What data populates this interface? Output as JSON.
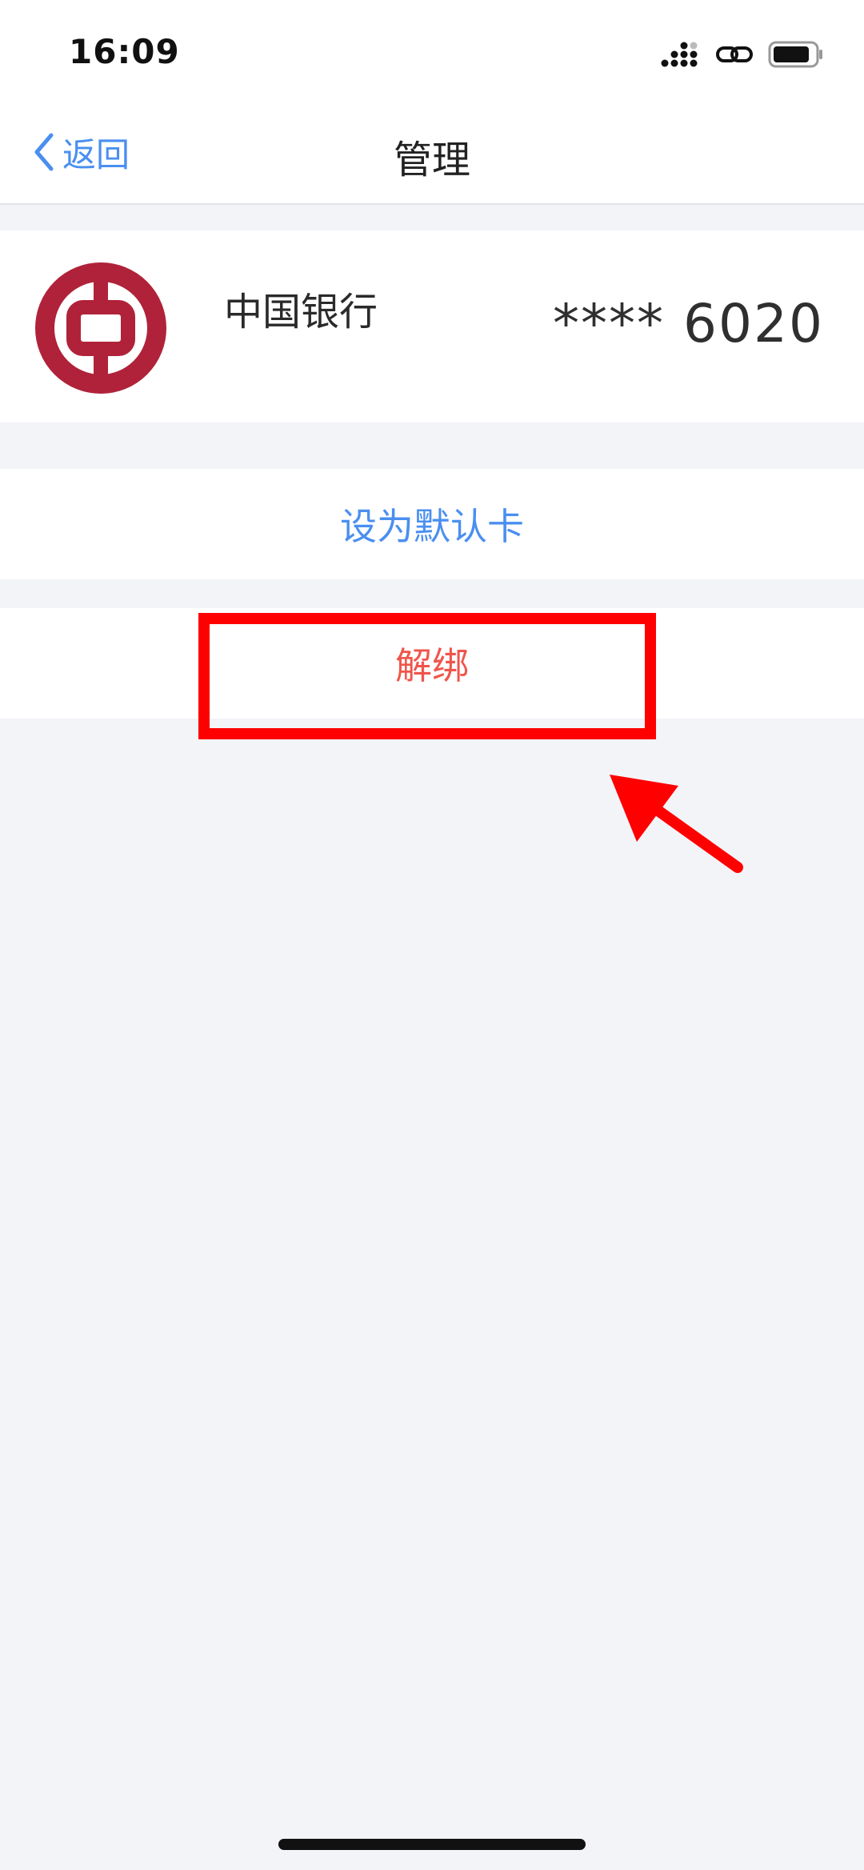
{
  "status_bar": {
    "time": "16:09",
    "icons": [
      "signal-icon",
      "link-icon",
      "battery-icon"
    ]
  },
  "nav": {
    "back_label": "返回",
    "title": "管理"
  },
  "card": {
    "bank_name": "中国银行",
    "card_number": "**** 6020",
    "logo": "bank-of-china-logo"
  },
  "actions": {
    "set_default_label": "设为默认卡",
    "unbind_label": "解绑"
  },
  "colors": {
    "accent_blue": "#4a8ff0",
    "danger_red": "#f0554a",
    "logo_red": "#b0223a",
    "annotation_red": "#ff0000",
    "background": "#f3f4f8"
  }
}
